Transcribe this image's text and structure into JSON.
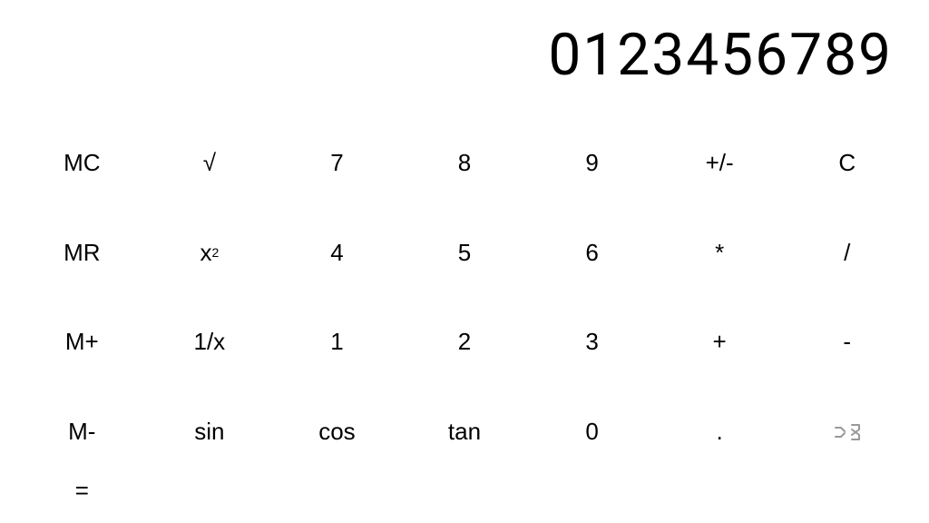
{
  "display": {
    "value": "0123456789"
  },
  "buttons": [
    {
      "id": "mc",
      "label": "MC",
      "row": 1,
      "col": 1
    },
    {
      "id": "sqrt",
      "label": "√",
      "row": 1,
      "col": 2
    },
    {
      "id": "7",
      "label": "7",
      "row": 1,
      "col": 3
    },
    {
      "id": "8",
      "label": "8",
      "row": 1,
      "col": 4
    },
    {
      "id": "9",
      "label": "9",
      "row": 1,
      "col": 5
    },
    {
      "id": "plus-minus",
      "label": "+/-",
      "row": 1,
      "col": 6
    },
    {
      "id": "clear",
      "label": "C",
      "row": 1,
      "col": 7
    },
    {
      "id": "mr",
      "label": "MR",
      "row": 2,
      "col": 1
    },
    {
      "id": "x-squared",
      "label": "x²",
      "row": 2,
      "col": 2
    },
    {
      "id": "4",
      "label": "4",
      "row": 2,
      "col": 3
    },
    {
      "id": "5",
      "label": "5",
      "row": 2,
      "col": 4
    },
    {
      "id": "6",
      "label": "6",
      "row": 2,
      "col": 5
    },
    {
      "id": "multiply",
      "label": "*",
      "row": 2,
      "col": 6
    },
    {
      "id": "divide",
      "label": "/",
      "row": 2,
      "col": 7
    },
    {
      "id": "m-plus",
      "label": "M+",
      "row": 3,
      "col": 1
    },
    {
      "id": "reciprocal",
      "label": "1/x",
      "row": 3,
      "col": 2
    },
    {
      "id": "1",
      "label": "1",
      "row": 3,
      "col": 3
    },
    {
      "id": "2",
      "label": "2",
      "row": 3,
      "col": 4
    },
    {
      "id": "3",
      "label": "3",
      "row": 3,
      "col": 5
    },
    {
      "id": "plus",
      "label": "+",
      "row": 3,
      "col": 6
    },
    {
      "id": "minus",
      "label": "-",
      "row": 3,
      "col": 7
    },
    {
      "id": "m-minus",
      "label": "M-",
      "row": 4,
      "col": 1
    },
    {
      "id": "sin",
      "label": "sin",
      "row": 4,
      "col": 2
    },
    {
      "id": "cos",
      "label": "cos",
      "row": 4,
      "col": 3
    },
    {
      "id": "tan",
      "label": "tan",
      "row": 4,
      "col": 4
    },
    {
      "id": "0",
      "label": "0",
      "row": 4,
      "col": 5
    },
    {
      "id": "decimal",
      "label": ".",
      "row": 4,
      "col": 6
    },
    {
      "id": "shuffle",
      "label": "shuffle",
      "row": 4,
      "col": 7
    },
    {
      "id": "equals",
      "label": "=",
      "row": 4,
      "col": 8
    }
  ]
}
